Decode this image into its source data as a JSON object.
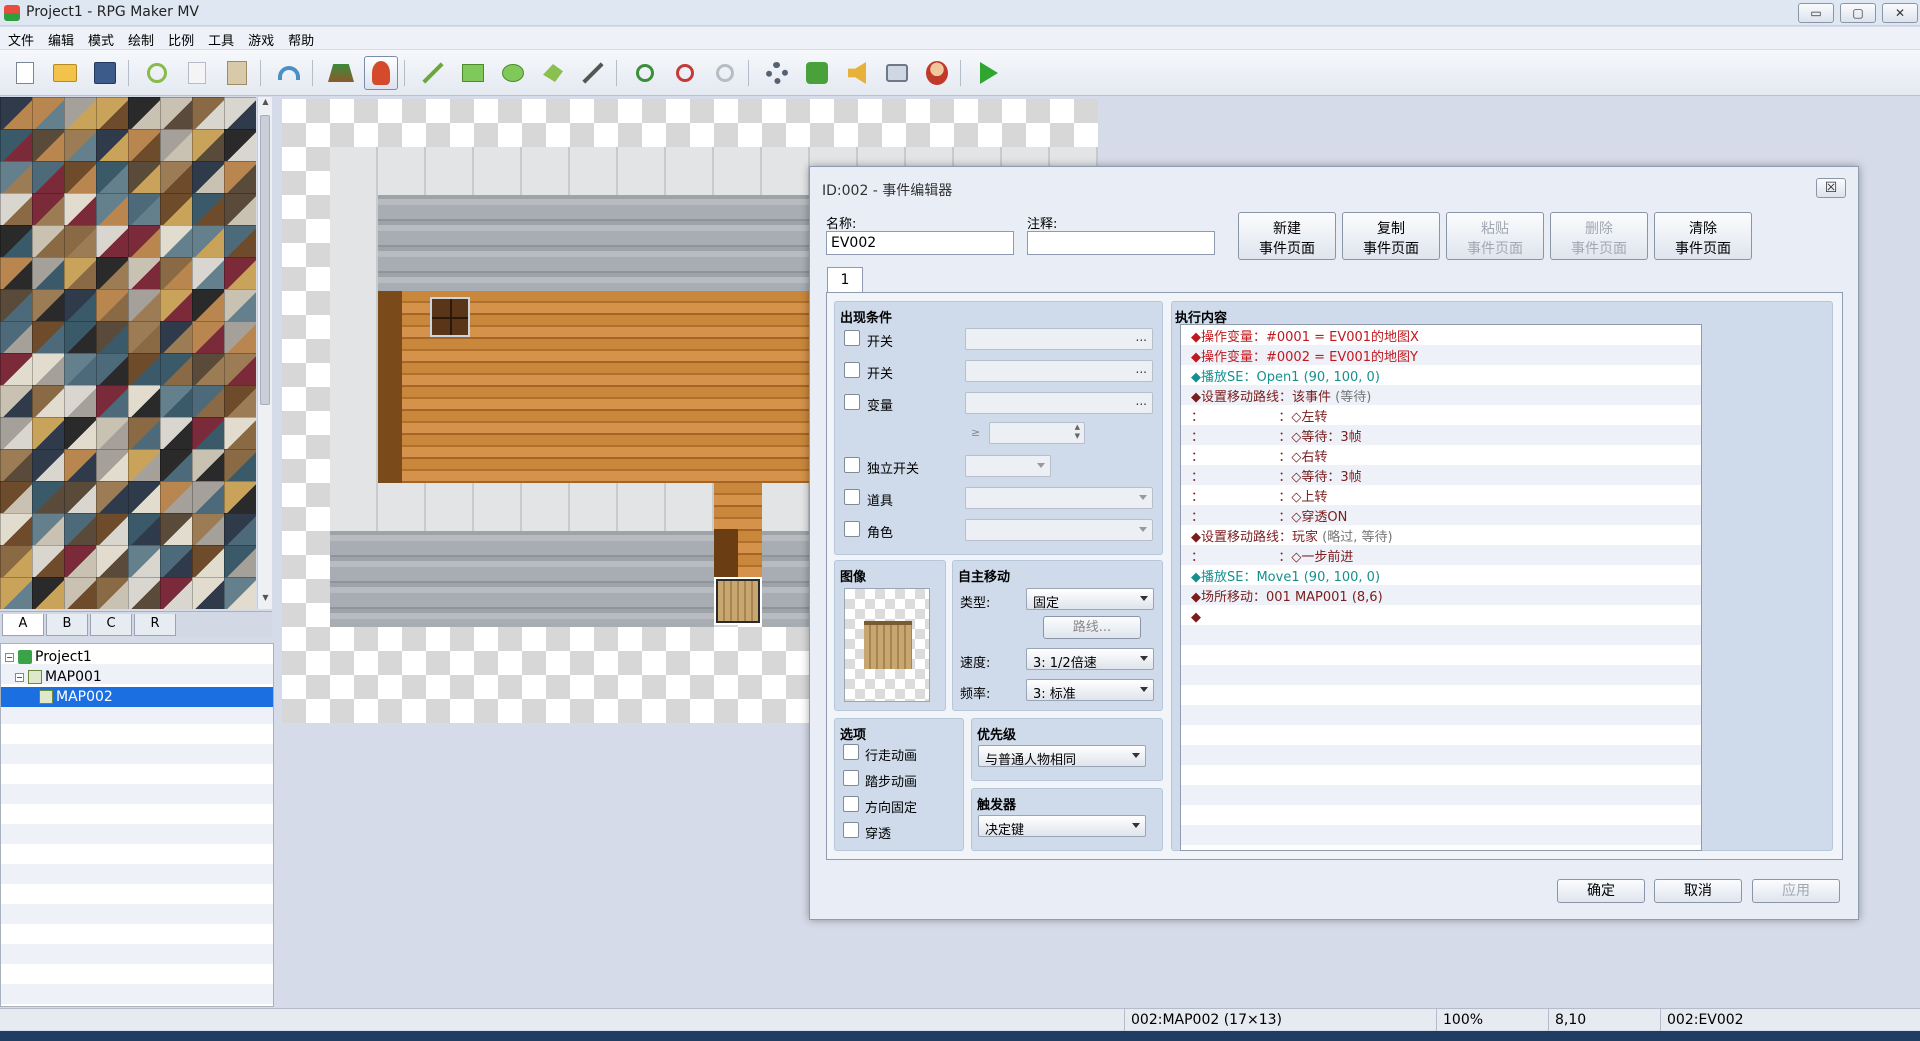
{
  "window": {
    "title": "Project1 - RPG Maker MV",
    "buttons": {
      "minimize": "▭",
      "maximize": "▢",
      "close": "✕"
    }
  },
  "menu": [
    "文件",
    "编辑",
    "模式",
    "绘制",
    "比例",
    "工具",
    "游戏",
    "帮助"
  ],
  "toolbar": [
    {
      "name": "new-project-icon",
      "glyph": "doc"
    },
    {
      "name": "open-project-icon",
      "glyph": "folder"
    },
    {
      "name": "save-project-icon",
      "glyph": "save"
    },
    {
      "name": "cut-icon",
      "glyph": "cut"
    },
    {
      "name": "copy-icon",
      "glyph": "copy"
    },
    {
      "name": "paste-icon",
      "glyph": "paste"
    },
    {
      "name": "undo-icon",
      "glyph": "undo"
    },
    {
      "name": "map-mode-icon",
      "glyph": "map"
    },
    {
      "name": "event-mode-icon",
      "glyph": "event"
    },
    {
      "name": "pencil-icon",
      "glyph": "pencil"
    },
    {
      "name": "rectangle-icon",
      "glyph": "rect"
    },
    {
      "name": "ellipse-icon",
      "glyph": "ellipse"
    },
    {
      "name": "fill-icon",
      "glyph": "fill"
    },
    {
      "name": "shadow-pen-icon",
      "glyph": "shadow"
    },
    {
      "name": "zoom-in-icon",
      "glyph": "zoomin"
    },
    {
      "name": "zoom-out-icon",
      "glyph": "zoomout"
    },
    {
      "name": "actual-size-icon",
      "glyph": "zoom11"
    },
    {
      "name": "database-icon",
      "glyph": "gear"
    },
    {
      "name": "plugin-manager-icon",
      "glyph": "puzzle"
    },
    {
      "name": "sound-test-icon",
      "glyph": "speaker"
    },
    {
      "name": "event-searcher-icon",
      "glyph": "search"
    },
    {
      "name": "character-generator-icon",
      "glyph": "face"
    },
    {
      "name": "playtest-icon",
      "glyph": "play"
    }
  ],
  "tileset_tabs": [
    "A",
    "B",
    "C",
    "R"
  ],
  "map_tree": [
    {
      "label": "Project1",
      "level": 0,
      "expander": "⊟"
    },
    {
      "label": "MAP001",
      "level": 1,
      "expander": "⊟"
    },
    {
      "label": "MAP002",
      "level": 2,
      "expander": "",
      "selected": true
    }
  ],
  "status": {
    "map": "002:MAP002 (17×13)",
    "zoom": "100%",
    "coords": "8,10",
    "event": "002:EV002"
  },
  "dialog": {
    "title": "ID:002 - 事件编辑器",
    "close": "☒",
    "name_label": "名称:",
    "name_value": "EV002",
    "note_label": "注释:",
    "note_value": "",
    "page_buttons": [
      {
        "line1": "新建",
        "line2": "事件页面",
        "enabled": true
      },
      {
        "line1": "复制",
        "line2": "事件页面",
        "enabled": true
      },
      {
        "line1": "粘贴",
        "line2": "事件页面",
        "enabled": false
      },
      {
        "line1": "删除",
        "line2": "事件页面",
        "enabled": false
      },
      {
        "line1": "清除",
        "line2": "事件页面",
        "enabled": true
      }
    ],
    "page_tab": "1",
    "conditions": {
      "title": "出现条件",
      "switch1": "开关",
      "switch2": "开关",
      "variable": "变量",
      "ge": "≥",
      "self_switch": "独立开关",
      "item": "道具",
      "actor": "角色",
      "dots": "..."
    },
    "image": {
      "title": "图像"
    },
    "autonomous": {
      "title": "自主移动",
      "type_label": "类型:",
      "type_value": "固定",
      "route_button": "路线...",
      "speed_label": "速度:",
      "speed_value": "3: 1/2倍速",
      "freq_label": "频率:",
      "freq_value": "3: 标准"
    },
    "options": {
      "title": "选项",
      "items": [
        "行走动画",
        "踏步动画",
        "方向固定",
        "穿透"
      ]
    },
    "priority": {
      "title": "优先级",
      "value": "与普通人物相同"
    },
    "trigger": {
      "title": "触发器",
      "value": "决定键"
    },
    "contents": {
      "title": "执行内容",
      "lines": [
        {
          "text": "◆操作变量：#0001 = EV001的地图X",
          "color": "red"
        },
        {
          "text": "◆操作变量：#0002 = EV001的地图Y",
          "color": "red"
        },
        {
          "text": "◆播放SE：Open1 (90, 100, 0)",
          "color": "teal"
        },
        {
          "text": "◆设置移动路线：该事件 ",
          "suffix": "(等待)",
          "color": "dark"
        },
        {
          "text": "：                  ：◇左转",
          "color": "dark"
        },
        {
          "text": "：                  ：◇等待：3帧",
          "color": "dark"
        },
        {
          "text": "：                  ：◇右转",
          "color": "dark"
        },
        {
          "text": "：                  ：◇等待：3帧",
          "color": "dark"
        },
        {
          "text": "：                  ：◇上转",
          "color": "dark"
        },
        {
          "text": "：                  ：◇穿透ON",
          "color": "dark"
        },
        {
          "text": "◆设置移动路线：玩家 ",
          "suffix": "(略过, 等待)",
          "color": "dark"
        },
        {
          "text": "：                  ：◇一步前进",
          "color": "dark"
        },
        {
          "text": "◆播放SE：Move1 (90, 100, 0)",
          "color": "teal"
        },
        {
          "text": "◆场所移动：001 MAP001 (8,6)",
          "color": "dark"
        },
        {
          "text": "◆",
          "color": "dark"
        }
      ]
    },
    "ok": "确定",
    "cancel": "取消",
    "apply": "应用"
  },
  "colors": {
    "selection": "#1b6fe0",
    "red": "#c0181f",
    "teal": "#178f8f",
    "dark": "#7a1d1d"
  }
}
